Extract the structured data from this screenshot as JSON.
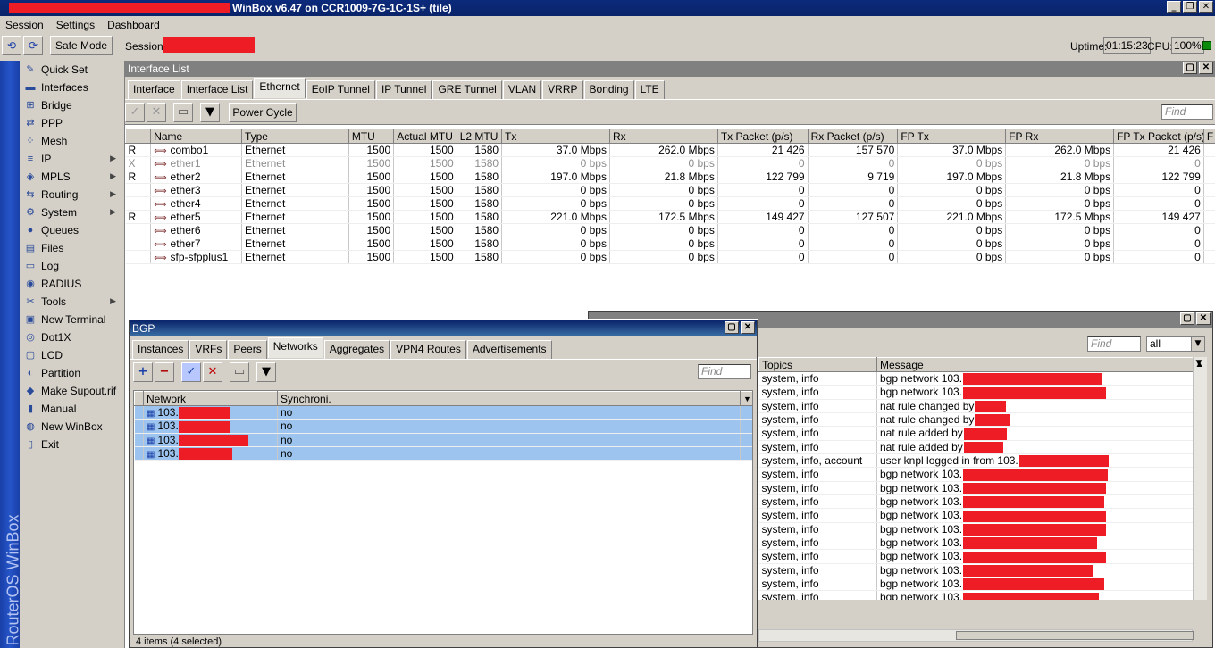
{
  "window": {
    "title": "WinBox v6.47 on CCR1009-7G-1C-1S+ (tile)"
  },
  "menubar": [
    "Session",
    "Settings",
    "Dashboard"
  ],
  "toolbar": {
    "undo": "⟲",
    "redo": "⟳",
    "safe_mode": "Safe Mode",
    "session_label": "Session:",
    "uptime_label": "Uptime:",
    "uptime": "01:15:23",
    "cpu_label": "CPU:",
    "cpu": "100%"
  },
  "sidebar_label": "RouterOS WinBox",
  "menu": [
    {
      "label": "Quick Set",
      "icon": "quick-set-icon",
      "glyph": "✎",
      "sub": false
    },
    {
      "label": "Interfaces",
      "icon": "interfaces-icon",
      "glyph": "▬",
      "sub": false
    },
    {
      "label": "Bridge",
      "icon": "bridge-icon",
      "glyph": "⊞",
      "sub": false
    },
    {
      "label": "PPP",
      "icon": "ppp-icon",
      "glyph": "⇄",
      "sub": false
    },
    {
      "label": "Mesh",
      "icon": "mesh-icon",
      "glyph": "⁘",
      "sub": false
    },
    {
      "label": "IP",
      "icon": "ip-icon",
      "glyph": "≡",
      "sub": true
    },
    {
      "label": "MPLS",
      "icon": "mpls-icon",
      "glyph": "◈",
      "sub": true
    },
    {
      "label": "Routing",
      "icon": "routing-icon",
      "glyph": "⇆",
      "sub": true
    },
    {
      "label": "System",
      "icon": "system-icon",
      "glyph": "⚙",
      "sub": true
    },
    {
      "label": "Queues",
      "icon": "queues-icon",
      "glyph": "●",
      "sub": false
    },
    {
      "label": "Files",
      "icon": "files-icon",
      "glyph": "▤",
      "sub": false
    },
    {
      "label": "Log",
      "icon": "log-icon",
      "glyph": "▭",
      "sub": false
    },
    {
      "label": "RADIUS",
      "icon": "radius-icon",
      "glyph": "◉",
      "sub": false
    },
    {
      "label": "Tools",
      "icon": "tools-icon",
      "glyph": "✂",
      "sub": true
    },
    {
      "label": "New Terminal",
      "icon": "terminal-icon",
      "glyph": "▣",
      "sub": false
    },
    {
      "label": "Dot1X",
      "icon": "dot1x-icon",
      "glyph": "◎",
      "sub": false
    },
    {
      "label": "LCD",
      "icon": "lcd-icon",
      "glyph": "▢",
      "sub": false
    },
    {
      "label": "Partition",
      "icon": "partition-icon",
      "glyph": "◐",
      "sub": false
    },
    {
      "label": "Make Supout.rif",
      "icon": "supout-icon",
      "glyph": "◆",
      "sub": false
    },
    {
      "label": "Manual",
      "icon": "manual-icon",
      "glyph": "▮",
      "sub": false
    },
    {
      "label": "New WinBox",
      "icon": "winbox-icon",
      "glyph": "◍",
      "sub": false
    },
    {
      "label": "Exit",
      "icon": "exit-icon",
      "glyph": "▯",
      "sub": false
    }
  ],
  "iflist": {
    "title": "Interface List",
    "tabs": [
      "Interface",
      "Interface List",
      "Ethernet",
      "EoIP Tunnel",
      "IP Tunnel",
      "GRE Tunnel",
      "VLAN",
      "VRRP",
      "Bonding",
      "LTE"
    ],
    "active_tab": 2,
    "power_cycle": "Power Cycle",
    "find": "Find",
    "columns": [
      "",
      "Name",
      "Type",
      "MTU",
      "Actual MTU",
      "L2 MTU",
      "Tx",
      "Rx",
      "Tx Packet (p/s)",
      "Rx Packet (p/s)",
      "FP Tx",
      "FP Rx",
      "FP Tx Packet (p/s)",
      "F"
    ],
    "rows": [
      {
        "flag": "R",
        "name": "combo1",
        "type": "Ethernet",
        "mtu": "1500",
        "amtu": "1500",
        "l2mtu": "1580",
        "tx": "37.0 Mbps",
        "rx": "262.0 Mbps",
        "txp": "21 426",
        "rxp": "157 570",
        "fptx": "37.0 Mbps",
        "fprx": "262.0 Mbps",
        "fptxp": "21 426",
        "disabled": false
      },
      {
        "flag": "X",
        "name": "ether1",
        "type": "Ethernet",
        "mtu": "1500",
        "amtu": "1500",
        "l2mtu": "1580",
        "tx": "0 bps",
        "rx": "0 bps",
        "txp": "0",
        "rxp": "0",
        "fptx": "0 bps",
        "fprx": "0 bps",
        "fptxp": "0",
        "disabled": true
      },
      {
        "flag": "R",
        "name": "ether2",
        "type": "Ethernet",
        "mtu": "1500",
        "amtu": "1500",
        "l2mtu": "1580",
        "tx": "197.0 Mbps",
        "rx": "21.8 Mbps",
        "txp": "122 799",
        "rxp": "9 719",
        "fptx": "197.0 Mbps",
        "fprx": "21.8 Mbps",
        "fptxp": "122 799",
        "disabled": false
      },
      {
        "flag": "",
        "name": "ether3",
        "type": "Ethernet",
        "mtu": "1500",
        "amtu": "1500",
        "l2mtu": "1580",
        "tx": "0 bps",
        "rx": "0 bps",
        "txp": "0",
        "rxp": "0",
        "fptx": "0 bps",
        "fprx": "0 bps",
        "fptxp": "0",
        "disabled": false
      },
      {
        "flag": "",
        "name": "ether4",
        "type": "Ethernet",
        "mtu": "1500",
        "amtu": "1500",
        "l2mtu": "1580",
        "tx": "0 bps",
        "rx": "0 bps",
        "txp": "0",
        "rxp": "0",
        "fptx": "0 bps",
        "fprx": "0 bps",
        "fptxp": "0",
        "disabled": false
      },
      {
        "flag": "R",
        "name": "ether5",
        "type": "Ethernet",
        "mtu": "1500",
        "amtu": "1500",
        "l2mtu": "1580",
        "tx": "221.0 Mbps",
        "rx": "172.5 Mbps",
        "txp": "149 427",
        "rxp": "127 507",
        "fptx": "221.0 Mbps",
        "fprx": "172.5 Mbps",
        "fptxp": "149 427",
        "disabled": false
      },
      {
        "flag": "",
        "name": "ether6",
        "type": "Ethernet",
        "mtu": "1500",
        "amtu": "1500",
        "l2mtu": "1580",
        "tx": "0 bps",
        "rx": "0 bps",
        "txp": "0",
        "rxp": "0",
        "fptx": "0 bps",
        "fprx": "0 bps",
        "fptxp": "0",
        "disabled": false
      },
      {
        "flag": "",
        "name": "ether7",
        "type": "Ethernet",
        "mtu": "1500",
        "amtu": "1500",
        "l2mtu": "1580",
        "tx": "0 bps",
        "rx": "0 bps",
        "txp": "0",
        "rxp": "0",
        "fptx": "0 bps",
        "fprx": "0 bps",
        "fptxp": "0",
        "disabled": false
      },
      {
        "flag": "",
        "name": "sfp-sfpplus1",
        "type": "Ethernet",
        "mtu": "1500",
        "amtu": "1500",
        "l2mtu": "1580",
        "tx": "0 bps",
        "rx": "0 bps",
        "txp": "0",
        "rxp": "0",
        "fptx": "0 bps",
        "fprx": "0 bps",
        "fptxp": "0",
        "disabled": false
      }
    ]
  },
  "bgp": {
    "title": "BGP",
    "tabs": [
      "Instances",
      "VRFs",
      "Peers",
      "Networks",
      "Aggregates",
      "VPN4 Routes",
      "Advertisements"
    ],
    "active_tab": 3,
    "find": "Find",
    "columns": [
      "Network",
      "Synchroni..."
    ],
    "rows": [
      {
        "network": "103.",
        "sync": "no"
      },
      {
        "network": "103.",
        "sync": "no"
      },
      {
        "network": "103.",
        "sync": "no"
      },
      {
        "network": "103.",
        "sync": "no"
      }
    ],
    "status": "4 items (4 selected)"
  },
  "log": {
    "find": "Find",
    "filter": "all",
    "columns": [
      "Topics",
      "Message"
    ],
    "rows": [
      {
        "topics": "system, info",
        "message": "bgp network 103."
      },
      {
        "topics": "system, info",
        "message": "bgp network 103."
      },
      {
        "topics": "system, info",
        "message": "nat rule changed by"
      },
      {
        "topics": "system, info",
        "message": "nat rule changed by"
      },
      {
        "topics": "system, info",
        "message": "nat rule added by"
      },
      {
        "topics": "system, info",
        "message": "nat rule added by"
      },
      {
        "topics": "system, info, account",
        "message": "user knpl logged in from 103."
      },
      {
        "topics": "system, info",
        "message": "bgp network 103."
      },
      {
        "topics": "system, info",
        "message": "bgp network 103."
      },
      {
        "topics": "system, info",
        "message": "bgp network 103."
      },
      {
        "topics": "system, info",
        "message": "bgp network 103."
      },
      {
        "topics": "system, info",
        "message": "bgp network 103."
      },
      {
        "topics": "system, info",
        "message": "bgp network 103."
      },
      {
        "topics": "system, info",
        "message": "bgp network 103."
      },
      {
        "topics": "system, info",
        "message": "bgp network 103."
      },
      {
        "topics": "system, info",
        "message": "bgp network 103."
      },
      {
        "topics": "system, info",
        "message": "bgp network 103."
      }
    ]
  },
  "colors": {
    "redaction": "#ee1c25",
    "selection": "#9cc4ee",
    "title_active": "#0a246a"
  }
}
